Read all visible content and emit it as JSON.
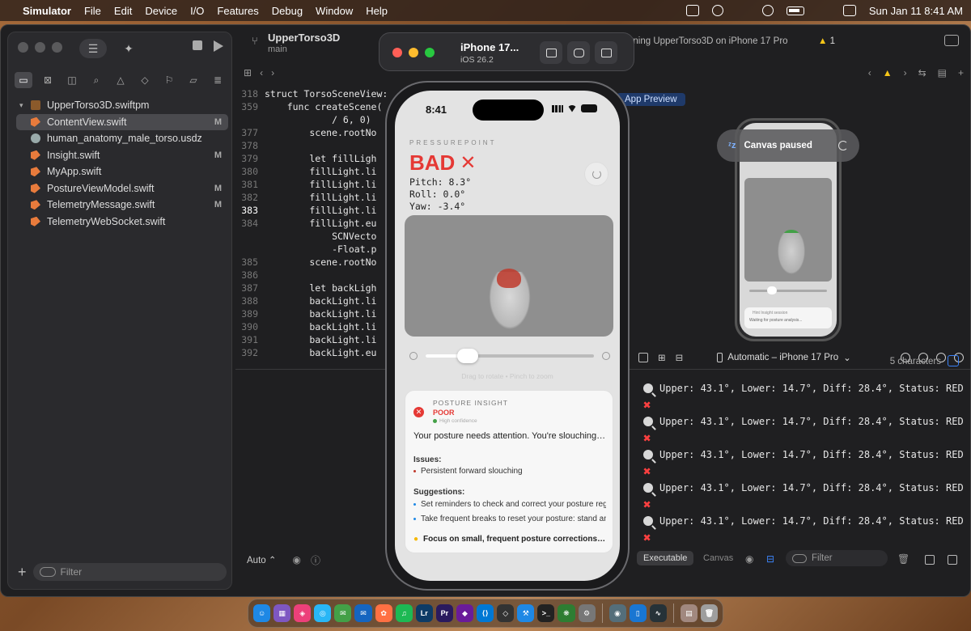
{
  "menubar": {
    "app": "Simulator",
    "items": [
      "File",
      "Edit",
      "Device",
      "I/O",
      "Features",
      "Debug",
      "Window",
      "Help"
    ],
    "clock": "Sun Jan 11  8:41 AM"
  },
  "xcode": {
    "project_name": "UpperTorso3D",
    "branch": "main",
    "run_status": "nning UpperTorso3D on iPhone 17 Pro",
    "warning_count": "1",
    "files": [
      {
        "name": "UpperTorso3D.swiftpm",
        "badge": "",
        "type": "pkg"
      },
      {
        "name": "ContentView.swift",
        "badge": "M",
        "type": "swift"
      },
      {
        "name": "human_anatomy_male_torso.usdz",
        "badge": "",
        "type": "usdz"
      },
      {
        "name": "Insight.swift",
        "badge": "M",
        "type": "swift"
      },
      {
        "name": "MyApp.swift",
        "badge": "",
        "type": "swift"
      },
      {
        "name": "PostureViewModel.swift",
        "badge": "M",
        "type": "swift"
      },
      {
        "name": "TelemetryMessage.swift",
        "badge": "M",
        "type": "swift"
      },
      {
        "name": "TelemetryWebSocket.swift",
        "badge": "",
        "type": "swift"
      }
    ],
    "filter_placeholder": "Filter",
    "code_lines": [
      {
        "ln": "318",
        "text": "struct TorsoSceneView:"
      },
      {
        "ln": "359",
        "text": "    func createScene("
      },
      {
        "ln": "",
        "text": "            / 6, 0)"
      },
      {
        "ln": "377",
        "text": "        scene.rootNo"
      },
      {
        "ln": "378",
        "text": ""
      },
      {
        "ln": "379",
        "text": "        let fillLigh"
      },
      {
        "ln": "380",
        "text": "        fillLight.li"
      },
      {
        "ln": "381",
        "text": "        fillLight.li"
      },
      {
        "ln": "382",
        "text": "        fillLight.li"
      },
      {
        "ln": "383",
        "text": "        fillLight.li"
      },
      {
        "ln": "384",
        "text": "        fillLight.eu"
      },
      {
        "ln": "",
        "text": "            SCNVecto"
      },
      {
        "ln": "",
        "text": "            -Float.p"
      },
      {
        "ln": "385",
        "text": "        scene.rootNo"
      },
      {
        "ln": "386",
        "text": ""
      },
      {
        "ln": "387",
        "text": "        let backLigh"
      },
      {
        "ln": "388",
        "text": "        backLight.li"
      },
      {
        "ln": "389",
        "text": "        backLight.li"
      },
      {
        "ln": "390",
        "text": "        backLight.li"
      },
      {
        "ln": "391",
        "text": "        backLight.li"
      },
      {
        "ln": "392",
        "text": "        backLight.eu"
      }
    ],
    "current_line": "383",
    "char_count": "5 characters",
    "app_preview_tab": "App Preview",
    "canvas_paused": "Canvas paused",
    "device_selector": "Automatic – iPhone 17 Pro",
    "auto_label": "Auto",
    "executable_label": "Executable",
    "canvas_label": "Canvas",
    "console_filter": "Filter",
    "console_lines": [
      "Upper: 43.1°, Lower: 14.7°, Diff: 28.4°, Status: RED",
      "Upper: 43.1°, Lower: 14.7°, Diff: 28.4°, Status: RED",
      "Upper: 43.1°, Lower: 14.7°, Diff: 28.4°, Status: RED",
      "Upper: 43.1°, Lower: 14.7°, Diff: 28.4°, Status: RED",
      "Upper: 43.1°, Lower: 14.7°, Diff: 28.4°, Status: RED"
    ],
    "console_mark": "✖"
  },
  "simulator": {
    "device": "iPhone 17...",
    "os": "iOS 26.2"
  },
  "app": {
    "time": "8:41",
    "brand": "PRESSUREPOINT",
    "status": "BAD",
    "status_mark": "✕",
    "pitch": "Pitch: 8.3°",
    "roll": "Roll: 0.0°",
    "yaw": "Yaw: -3.4°",
    "zoom_level": 0.25,
    "hint": "Drag to rotate • Pinch to zoom",
    "insight": {
      "header": "POSTURE INSIGHT",
      "rating": "POOR",
      "confidence": "High confidence",
      "summary": "Your posture needs attention. You're slouching forward.",
      "issues_label": "Issues:",
      "issues": [
        "Persistent forward slouching"
      ],
      "suggestions_label": "Suggestions:",
      "suggestions": [
        "Set reminders to check and correct your posture regularly",
        "Take frequent breaks to reset your posture: stand and stretch"
      ],
      "tip": "Focus on small, frequent posture corrections throughout the day"
    }
  },
  "mini_preview": {
    "card_title": "Hint Insight session",
    "card_body": "Waiting for posture analysis..."
  },
  "colors": {
    "bad": "#e53935",
    "accent": "#3b82f6"
  }
}
